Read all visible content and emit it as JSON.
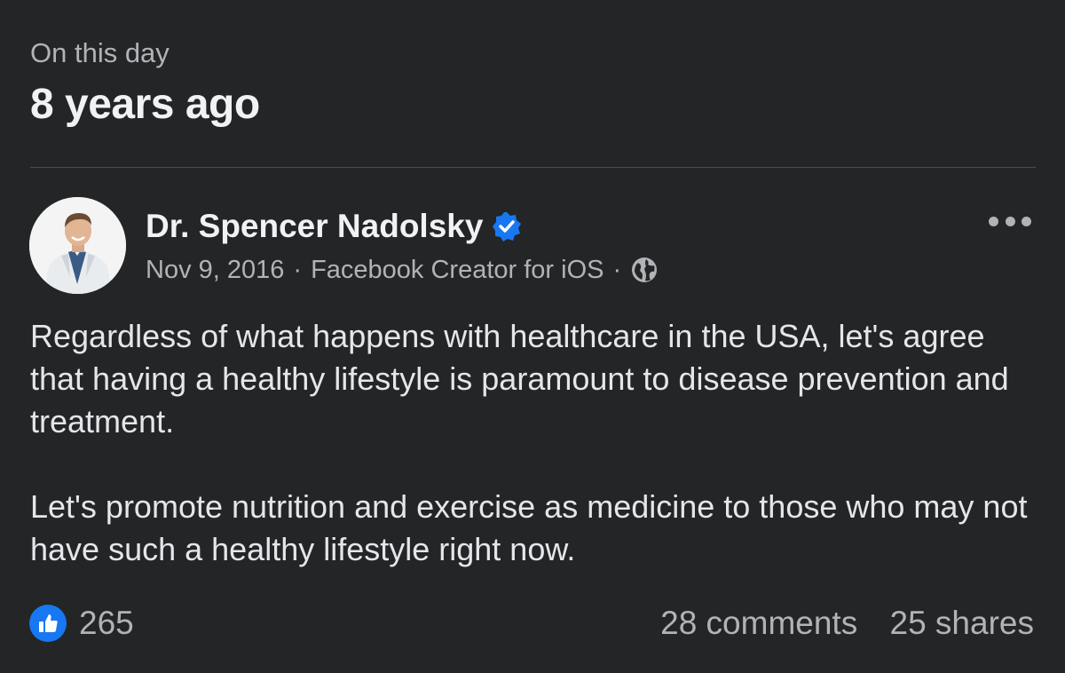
{
  "memory": {
    "label": "On this day",
    "years_ago": "8 years ago"
  },
  "post": {
    "author": "Dr. Spencer Nadolsky",
    "verified": true,
    "date": "Nov 9, 2016",
    "source": "Facebook Creator for iOS",
    "separator": "·",
    "audience_icon": "globe-icon",
    "more_icon": "more-options-icon",
    "paragraphs": [
      "Regardless of what happens with healthcare in the USA, let's agree that having a healthy lifestyle is paramount to disease prevention and treatment.",
      "Let's promote nutrition and exercise as medicine to those who may not have such a healthy lifestyle right now."
    ]
  },
  "engagement": {
    "likes": "265",
    "comments": "28 comments",
    "shares": "25 shares"
  },
  "colors": {
    "background": "#242526",
    "primary_text": "#e4e6eb",
    "secondary_text": "#b0b3b8",
    "accent": "#1877f2"
  }
}
